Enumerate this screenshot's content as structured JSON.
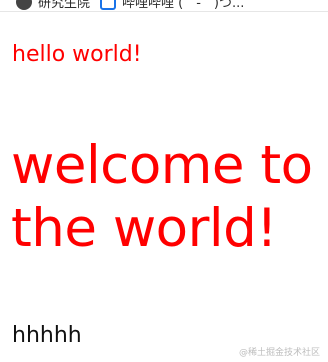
{
  "browser": {
    "bookmarks": [
      {
        "label": "研究生院",
        "icon": "circle-icon"
      },
      {
        "label": "哔哩哔哩 (゜-゜)つ...",
        "icon": "square-icon"
      }
    ]
  },
  "page": {
    "hello_text": "hello world!",
    "welcome_text": "welcome to the world!",
    "footer_text": "hhhhh",
    "watermark_text": "@稀土掘金技术社区",
    "colors": {
      "text_red": "#ff0000",
      "text_black": "#111111"
    }
  }
}
